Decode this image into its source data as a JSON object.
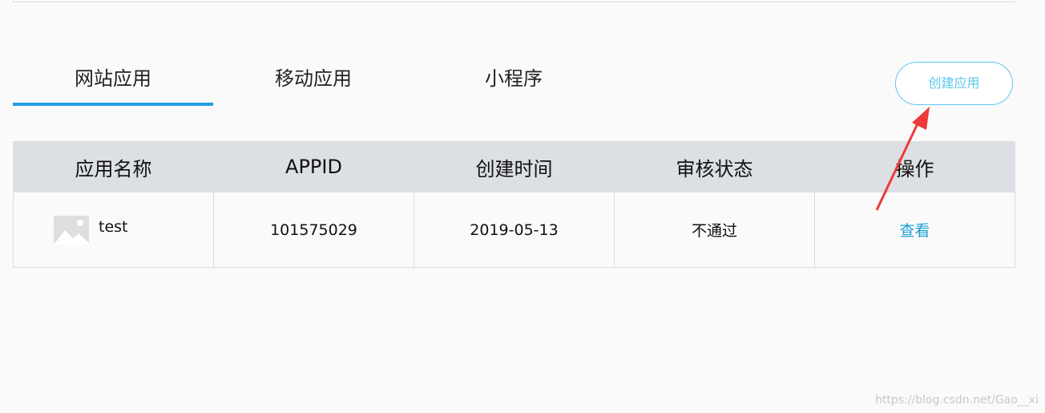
{
  "tabs": [
    {
      "label": "网站应用",
      "active": true
    },
    {
      "label": "移动应用",
      "active": false
    },
    {
      "label": "小程序",
      "active": false
    }
  ],
  "create_button": {
    "label": "创建应用"
  },
  "table": {
    "headers": [
      "应用名称",
      "APPID",
      "创建时间",
      "审核状态",
      "操作"
    ],
    "rows": [
      {
        "name": "test",
        "appid": "101575029",
        "created": "2019-05-13",
        "status": "不通过",
        "action": "查看"
      }
    ]
  },
  "watermark": "https://blog.csdn.net/Gao__xi",
  "colors": {
    "accent": "#1f9fe8",
    "button": "#5cc6ef",
    "status_fail": "#e5413c",
    "link": "#1a9fd3",
    "annotation_arrow": "#ee3a3a"
  }
}
